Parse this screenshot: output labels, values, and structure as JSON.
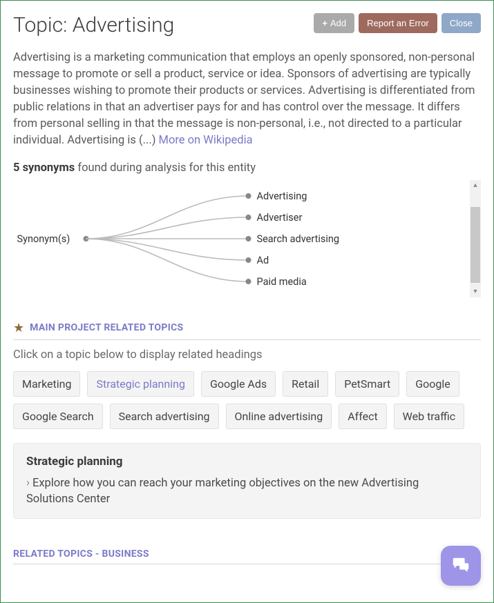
{
  "header": {
    "title": "Topic: Advertising",
    "add_label": "Add",
    "report_label": "Report an Error",
    "close_label": "Close"
  },
  "description": {
    "text": "Advertising is a marketing communication that employs an openly sponsored, non-personal message to promote or sell a product, service or idea. Sponsors of advertising are typically businesses wishing to promote their products or services. Advertising is differentiated from public relations in that an advertiser pays for and has control over the message. It differs from personal selling in that the message is non-personal, i.e., not directed to a particular individual. Advertising is (...) ",
    "more_label": "More on Wikipedia"
  },
  "synonyms": {
    "count_prefix": "5 synonyms",
    "count_suffix": " found during analysis for this entity",
    "root_label": "Synonym(s)",
    "items": [
      "Advertising",
      "Advertiser",
      "Search advertising",
      "Ad",
      "Paid media"
    ]
  },
  "main_related": {
    "section_label": "MAIN PROJECT RELATED TOPICS",
    "subtitle": "Click on a topic below to display related headings",
    "chips": [
      "Marketing",
      "Strategic planning",
      "Google Ads",
      "Retail",
      "PetSmart",
      "Google",
      "Google Search",
      "Search advertising",
      "Online advertising",
      "Affect",
      "Web traffic"
    ],
    "active_chip_index": 1
  },
  "expansion": {
    "title": "Strategic planning",
    "line": "Explore how you can reach your marketing objectives on the new Advertising Solutions Center"
  },
  "related_business": {
    "section_label": "RELATED TOPICS - BUSINESS"
  }
}
